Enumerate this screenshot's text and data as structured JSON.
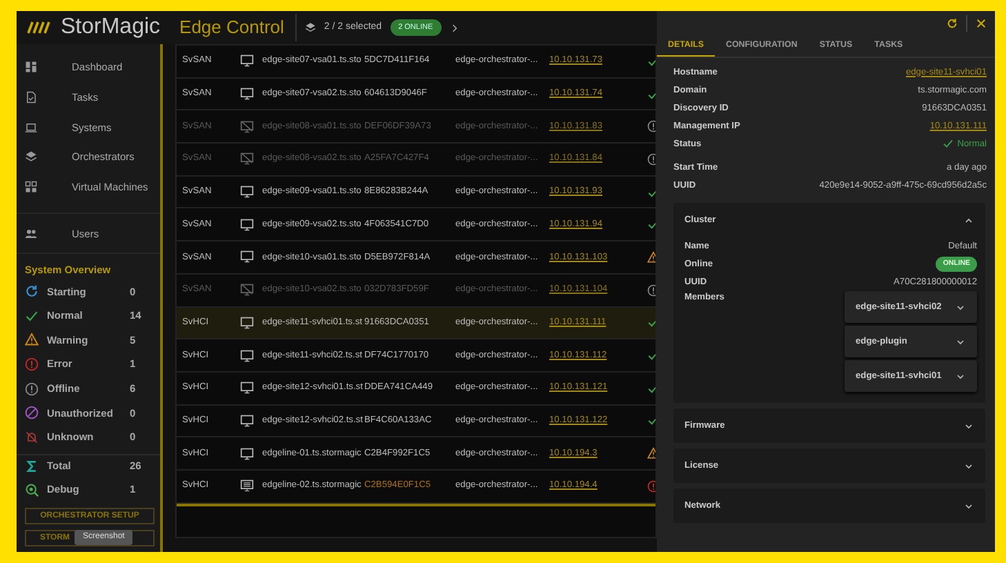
{
  "header": {
    "brand": "StorMagic",
    "product": "Edge Control",
    "selection": "2 / 2 selected",
    "online_badge": "2 ONLINE"
  },
  "sidebar": {
    "nav": [
      {
        "kind": "dashboard",
        "label": "Dashboard"
      },
      {
        "kind": "tasks",
        "label": "Tasks"
      },
      {
        "kind": "systems",
        "label": "Systems"
      },
      {
        "kind": "orchestrators",
        "label": "Orchestrators"
      },
      {
        "kind": "vms",
        "label": "Virtual Machines"
      },
      {
        "kind": "users",
        "label": "Users"
      }
    ],
    "overview": {
      "title": "System Overview",
      "items": [
        {
          "kind": "starting",
          "label": "Starting",
          "count": "0"
        },
        {
          "kind": "normal",
          "label": "Normal",
          "count": "14"
        },
        {
          "kind": "warning",
          "label": "Warning",
          "count": "5"
        },
        {
          "kind": "error",
          "label": "Error",
          "count": "1"
        },
        {
          "kind": "offline",
          "label": "Offline",
          "count": "6"
        },
        {
          "kind": "unauthorized",
          "label": "Unauthorized",
          "count": "0"
        },
        {
          "kind": "unknown",
          "label": "Unknown",
          "count": "0"
        },
        {
          "kind": "total",
          "label": "Total",
          "count": "26"
        },
        {
          "kind": "debug",
          "label": "Debug",
          "count": "1"
        }
      ]
    },
    "buttons": [
      "ORCHESTRATOR SETUP",
      "STORM"
    ],
    "tooltip": "Screenshot"
  },
  "table": {
    "rows": [
      {
        "kind": "normal",
        "type": "SvSAN",
        "hostname": "edge-site07-vsa01.ts.sto",
        "id": "5DC7D411F164",
        "orchestrator": "edge-orchestrator-...",
        "ip": "10.10.131.73",
        "selected": false
      },
      {
        "kind": "normal",
        "type": "SvSAN",
        "hostname": "edge-site07-vsa02.ts.sto",
        "id": "604613D9046F",
        "orchestrator": "edge-orchestrator-...",
        "ip": "10.10.131.74",
        "selected": false
      },
      {
        "kind": "offline",
        "type": "SvSAN",
        "hostname": "edge-site08-vsa01.ts.sto",
        "id": "DEF06DF39A73",
        "orchestrator": "edge-orchestrator-...",
        "ip": "10.10.131.83",
        "selected": false
      },
      {
        "kind": "offline",
        "type": "SvSAN",
        "hostname": "edge-site08-vsa02.ts.sto",
        "id": "A25FA7C427F4",
        "orchestrator": "edge-orchestrator-...",
        "ip": "10.10.131.84",
        "selected": false
      },
      {
        "kind": "normal",
        "type": "SvSAN",
        "hostname": "edge-site09-vsa01.ts.sto",
        "id": "8E86283B244A",
        "orchestrator": "edge-orchestrator-...",
        "ip": "10.10.131.93",
        "selected": false
      },
      {
        "kind": "normal",
        "type": "SvSAN",
        "hostname": "edge-site09-vsa02.ts.sto",
        "id": "4F063541C7D0",
        "orchestrator": "edge-orchestrator-...",
        "ip": "10.10.131.94",
        "selected": false
      },
      {
        "kind": "warning",
        "type": "SvSAN",
        "hostname": "edge-site10-vsa01.ts.sto",
        "id": "D5EB972F814A",
        "orchestrator": "edge-orchestrator-...",
        "ip": "10.10.131.103",
        "selected": false
      },
      {
        "kind": "offline",
        "type": "SvSAN",
        "hostname": "edge-site10-vsa02.ts.sto",
        "id": "032D783FD59F",
        "orchestrator": "edge-orchestrator-...",
        "ip": "10.10.131.104",
        "selected": false
      },
      {
        "kind": "normal",
        "type": "SvHCI",
        "hostname": "edge-site11-svhci01.ts.st",
        "id": "91663DCA0351",
        "orchestrator": "edge-orchestrator-...",
        "ip": "10.10.131.111",
        "selected": true
      },
      {
        "kind": "normal",
        "type": "SvHCI",
        "hostname": "edge-site11-svhci02.ts.st",
        "id": "DF74C1770170",
        "orchestrator": "edge-orchestrator-...",
        "ip": "10.10.131.112",
        "selected": false
      },
      {
        "kind": "normal",
        "type": "SvHCI",
        "hostname": "edge-site12-svhci01.ts.st",
        "id": "DDEA741CA449",
        "orchestrator": "edge-orchestrator-...",
        "ip": "10.10.131.121",
        "selected": false
      },
      {
        "kind": "normal",
        "type": "SvHCI",
        "hostname": "edge-site12-svhci02.ts.st",
        "id": "BF4C60A133AC",
        "orchestrator": "edge-orchestrator-...",
        "ip": "10.10.131.122",
        "selected": false
      },
      {
        "kind": "warning",
        "type": "SvHCI",
        "hostname": "edgeline-01.ts.stormagic",
        "id": "C2B4F992F1C5",
        "orchestrator": "edge-orchestrator-...",
        "ip": "10.10.194.3",
        "selected": false
      },
      {
        "kind": "error",
        "type": "SvHCI",
        "hostname": "edgeline-02.ts.stormagic",
        "id": "C2B594E0F1C5",
        "orchestrator": "edge-orchestrator-...",
        "ip": "10.10.194.4",
        "selected": false
      }
    ]
  },
  "panel": {
    "tabs": [
      {
        "label": "DETAILS",
        "selected": true
      },
      {
        "label": "CONFIGURATION",
        "selected": false
      },
      {
        "label": "STATUS",
        "selected": false
      },
      {
        "label": "TASKS",
        "selected": false
      }
    ],
    "detail_groups": [
      [
        {
          "label": "Hostname",
          "value": "edge-site11-svhci01",
          "kind": "link"
        },
        {
          "label": "Domain",
          "value": "ts.stormagic.com",
          "kind": "text"
        },
        {
          "label": "Discovery ID",
          "value": "91663DCA0351",
          "kind": "text"
        },
        {
          "label": "Management IP",
          "value": "10.10.131.111",
          "kind": "link"
        },
        {
          "label": "Status",
          "value": "Normal",
          "kind": "status"
        }
      ],
      [
        {
          "label": "Start Time",
          "value": "a day ago",
          "kind": "text"
        },
        {
          "label": "UUID",
          "value": "420e9e14-9052-a9ff-475c-69cd956d2a5c",
          "kind": "text"
        }
      ]
    ],
    "sections": [
      {
        "title": "Cluster",
        "expanded": true,
        "fields": [
          {
            "label": "Name",
            "value": "Default",
            "kind": "text"
          },
          {
            "label": "Online",
            "value": "ONLINE",
            "kind": "badge"
          },
          {
            "label": "UUID",
            "value": "A70C281800000012",
            "kind": "text"
          }
        ],
        "members_label": "Members",
        "members": [
          "edge-site11-svhci02",
          "edge-plugin",
          "edge-site11-svhci01"
        ]
      },
      {
        "title": "Firmware",
        "expanded": false
      },
      {
        "title": "License",
        "expanded": false
      },
      {
        "title": "Network",
        "expanded": false
      }
    ]
  }
}
